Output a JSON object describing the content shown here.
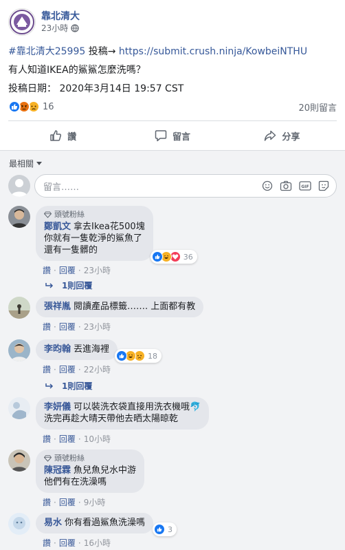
{
  "post": {
    "page_name": "靠北清大",
    "time": "23小時",
    "line1_hashtag": "#靠北清大25995",
    "line1_middle": " 投稿→ ",
    "line1_link": "https://submit.crush.ninja/KowbeiNTHU",
    "line2": "有人知道IKEA的鯊鯊怎麼洗嗎？",
    "line3": "投稿日期： 2020年3月14日 19:57 CST",
    "reaction_count": "16",
    "comment_count": "20則留言"
  },
  "actions": {
    "like": "讚",
    "comment": "留言",
    "share": "分享"
  },
  "comments_section": {
    "sort_label": "最相關",
    "composer_placeholder": "留言……"
  },
  "comments": [
    {
      "badge": "頭號粉絲",
      "author": "鄭凱文",
      "text": "拿去Ikea花500塊\n你就有一隻乾淨的鯊魚了\n還有一隻髒的",
      "like": "讚",
      "reply": "回覆",
      "time": "23小時",
      "reactions": "36",
      "reply_link": "1則回覆"
    },
    {
      "author": "張祥胤",
      "text": "閱讀產品標籤……. 上面都有教",
      "like": "讚",
      "reply": "回覆",
      "time": "23小時"
    },
    {
      "author": "李昀翰",
      "text": "丟進海裡",
      "like": "讚",
      "reply": "回覆",
      "time": "22小時",
      "reactions": "18",
      "reply_link": "1則回覆"
    },
    {
      "author": "李妍儀",
      "text": "可以裝洗衣袋直接用洗衣機哦🐬\n洗完再趁大晴天帶他去晒太陽晾乾",
      "like": "讚",
      "reply": "回覆",
      "time": "10小時"
    },
    {
      "badge": "頭號粉絲",
      "author": "陳冠霖",
      "text": "魚兒魚兒水中游\n他們有在洗澡嗎",
      "like": "讚",
      "reply": "回覆",
      "time": "9小時"
    },
    {
      "author": "易水",
      "text": "你有看過鯊魚洗澡嗎",
      "like": "讚",
      "reply": "回覆",
      "time": "16小時",
      "reactions": "3"
    }
  ],
  "colors": {
    "link": "#365899",
    "author": "#385898",
    "like_blue": "#1877f2",
    "angry": "#e9710f",
    "sad": "#f7b125",
    "love": "#f33e58"
  },
  "icons": [
    "page-logo-icon",
    "globe-icon",
    "like-reaction-icon",
    "angry-reaction-icon",
    "sad-reaction-icon",
    "haha-reaction-icon",
    "love-reaction-icon",
    "thumbs-up-icon",
    "comment-bubble-icon",
    "share-arrow-icon",
    "emoji-icon",
    "camera-icon",
    "gif-icon",
    "sticker-icon",
    "diamond-icon",
    "reply-arrow-icon"
  ]
}
